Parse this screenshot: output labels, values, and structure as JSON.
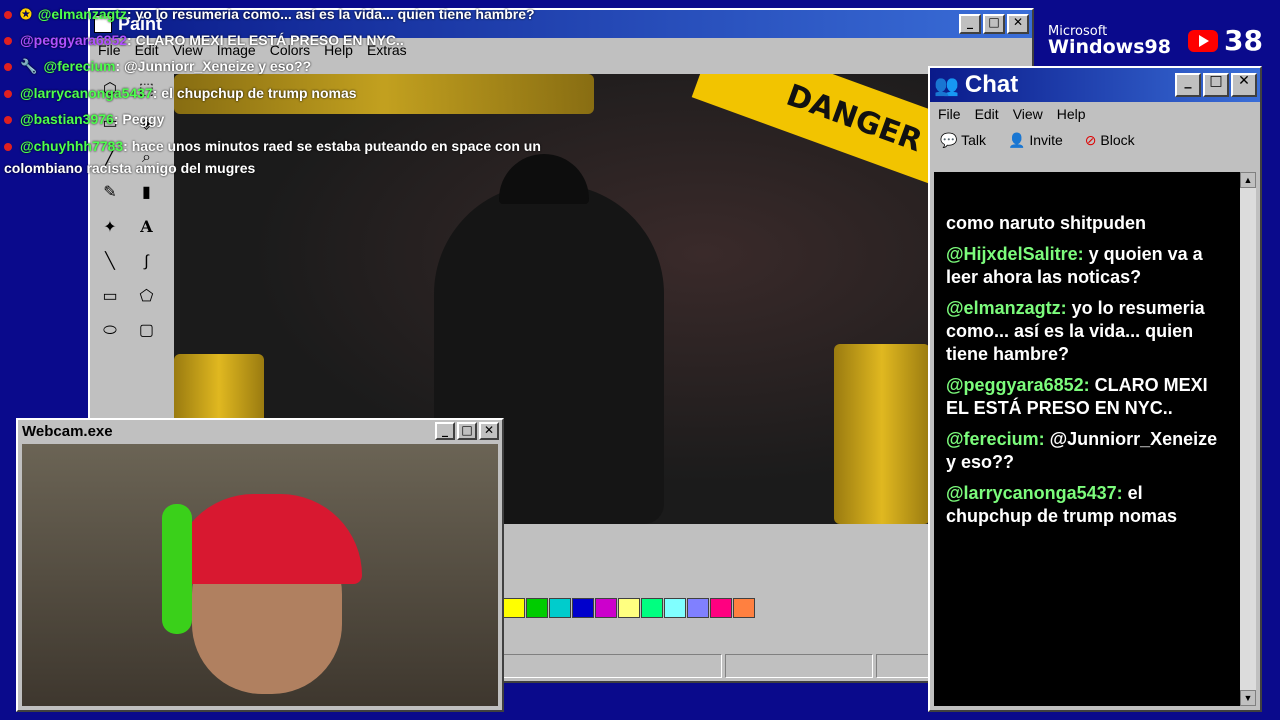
{
  "colors": {
    "desktop": "#0a0a8c",
    "chat_username": "#7CFC7C",
    "overlay_username": "#4dff4d",
    "overlay_username_purple": "#b050ff",
    "youtube_red": "#ff0000"
  },
  "branding": {
    "microsoft": "Microsoft",
    "windows": "Windows98",
    "viewer_count": "38"
  },
  "overlay_chat": [
    {
      "user": "@elmanzagtz",
      "text": ": yo lo resumeria como... así es la vida... quien tiene hambre?"
    },
    {
      "user": "@peggyara6852",
      "text": ": CLARO MEXI EL ESTÁ PRESO EN NYC.."
    },
    {
      "user": "@ferecium",
      "text": ": @Junniorr_Xeneize y eso??"
    },
    {
      "user": "@larrycanonga5437",
      "text": ": el chupchup de trump nomas"
    },
    {
      "user": "@bastian3976",
      "text": ": Peggy"
    },
    {
      "user": "@chuyhhh7783",
      "text": ": hace unos minutos raed se estaba puteando en space con un"
    },
    {
      "user": "",
      "text": "colombiano racista amigo del mugres"
    }
  ],
  "paint": {
    "title": "Paint",
    "menu": [
      "File",
      "Edit",
      "View",
      "Image",
      "Colors",
      "Help",
      "Extras"
    ],
    "banner": "DANGER",
    "palette": [
      "#ffff00",
      "#00cc00",
      "#00cccc",
      "#0000cc",
      "#cc00cc",
      "#ffff80",
      "#00ff80",
      "#80ffff",
      "#8080ff",
      "#ff0080",
      "#ff8040"
    ]
  },
  "webcam": {
    "title": "Webcam.exe"
  },
  "chat": {
    "title": "Chat",
    "menu": [
      "File",
      "Edit",
      "View",
      "Help"
    ],
    "toolbar": {
      "talk": "Talk",
      "invite": "Invite",
      "block": "Block"
    },
    "messages": [
      {
        "user": "",
        "text": "como naruto shitpuden"
      },
      {
        "user": "@HijxdelSalitre:",
        "text": "y quoien va a leer ahora las noticas?"
      },
      {
        "user": "@elmanzagtz:",
        "text": "yo lo resumeria como... así es la vida... quien tiene hambre?"
      },
      {
        "user": "@peggyara6852:",
        "text": "CLARO MEXI EL ESTÁ PRESO EN NYC.."
      },
      {
        "user": "@ferecium:",
        "text": "@Junniorr_Xeneize y eso??"
      },
      {
        "user": "@larrycanonga5437:",
        "text": "el chupchup de trump nomas"
      }
    ]
  },
  "icons": {
    "minimize": "minimize-icon",
    "maximize": "maximize-icon",
    "close": "close-icon"
  }
}
